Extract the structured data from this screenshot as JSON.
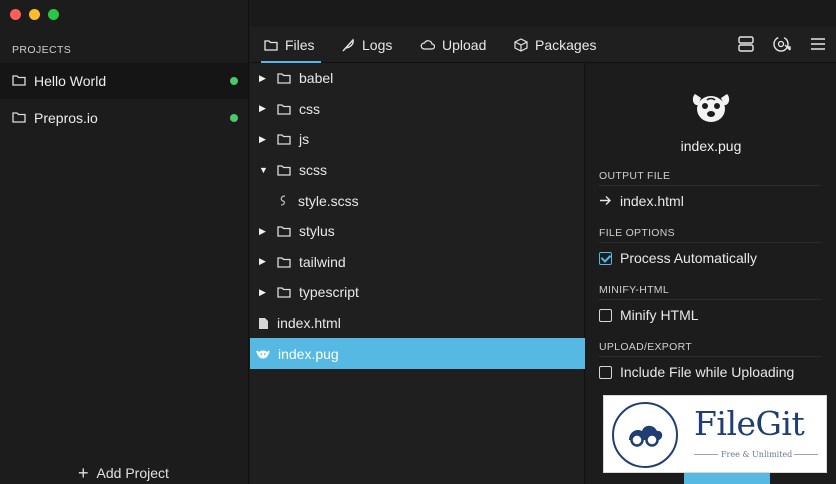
{
  "window": {
    "traffic_lights": [
      "close",
      "minimize",
      "zoom"
    ],
    "colors": {
      "close": "#fe5f57",
      "minimize": "#febc2e",
      "zoom": "#28c840",
      "accent": "#56b9e3",
      "status_dot": "#4cc76b"
    }
  },
  "sidebar": {
    "heading": "PROJECTS",
    "projects": [
      {
        "name": "Hello World",
        "status": "green-dot",
        "active": true
      },
      {
        "name": "Prepros.io",
        "status": "green-dot",
        "active": false
      }
    ],
    "add_project_label": "Add Project"
  },
  "tabs": [
    {
      "label": "Files",
      "icon": "folder-icon",
      "active": true
    },
    {
      "label": "Logs",
      "icon": "feather-icon",
      "active": false
    },
    {
      "label": "Upload",
      "icon": "cloud-icon",
      "active": false
    },
    {
      "label": "Packages",
      "icon": "package-icon",
      "active": false
    }
  ],
  "toolbar_icons": [
    "server-icon",
    "preview-icon",
    "menu-icon"
  ],
  "tree": [
    {
      "label": "babel",
      "type": "folder",
      "expanded": false
    },
    {
      "label": "css",
      "type": "folder",
      "expanded": false
    },
    {
      "label": "js",
      "type": "folder",
      "expanded": false
    },
    {
      "label": "scss",
      "type": "folder",
      "expanded": true
    },
    {
      "label": "style.scss",
      "type": "sass-file",
      "indent": true
    },
    {
      "label": "stylus",
      "type": "folder",
      "expanded": false
    },
    {
      "label": "tailwind",
      "type": "folder",
      "expanded": false
    },
    {
      "label": "typescript",
      "type": "folder",
      "expanded": false
    },
    {
      "label": "index.html",
      "type": "file"
    },
    {
      "label": "index.pug",
      "type": "pug-file",
      "selected": true
    }
  ],
  "details": {
    "file_name": "index.pug",
    "output_file_heading": "OUTPUT FILE",
    "output_file": "index.html",
    "file_options_heading": "FILE OPTIONS",
    "process_automatically": {
      "label": "Process Automatically",
      "checked": true
    },
    "minify_heading": "MINIFY-HTML",
    "minify_html": {
      "label": "Minify HTML",
      "checked": false
    },
    "upload_heading": "UPLOAD/EXPORT",
    "include_upload": {
      "label": "Include File while Uploading",
      "checked": false
    }
  },
  "watermark": {
    "title": "FileGit",
    "subtitle": "Free & Unlimited"
  }
}
